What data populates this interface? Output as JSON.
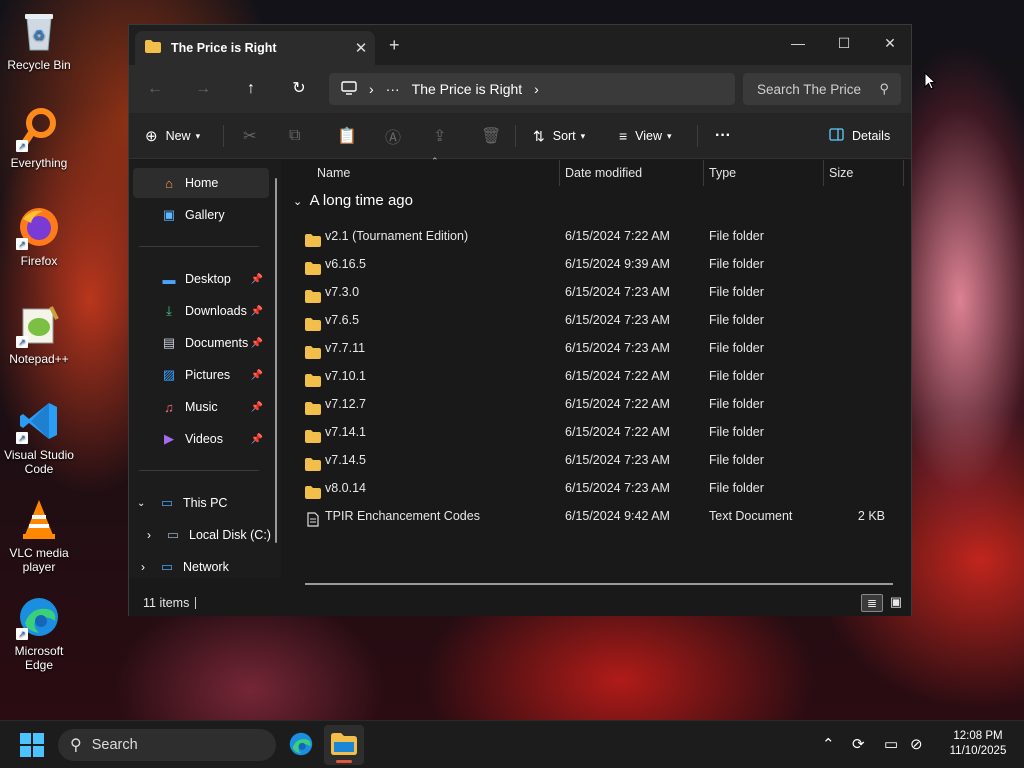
{
  "desktop": {
    "icons": [
      {
        "label": "Recycle Bin",
        "icon": "recycle-bin-icon"
      },
      {
        "label": "Everything",
        "icon": "everything-search-icon"
      },
      {
        "label": "Firefox",
        "icon": "firefox-icon"
      },
      {
        "label": "Notepad++",
        "icon": "notepad-plus-plus-icon"
      },
      {
        "label": "Visual Studio Code",
        "icon": "vscode-icon"
      },
      {
        "label": "VLC media player",
        "icon": "vlc-icon"
      },
      {
        "label": "Microsoft Edge",
        "icon": "edge-icon"
      }
    ]
  },
  "window": {
    "tab_title": "The Price is Right",
    "new_tab_symbol": "+",
    "controls": {
      "minimize": "—",
      "maximize": "☐",
      "close": "✕"
    },
    "nav": {
      "back": "←",
      "forward": "→",
      "up": "↑",
      "refresh": "↻"
    },
    "address": {
      "more": "···",
      "crumb": "The Price is Right"
    },
    "search_placeholder": "Search The Price",
    "toolbar": {
      "new_label": "New",
      "sort_label": "Sort",
      "view_label": "View",
      "more_label": "···",
      "details_label": "Details"
    }
  },
  "sidebar": {
    "home": "Home",
    "gallery": "Gallery",
    "quick_access": [
      {
        "label": "Desktop",
        "icon": "desktop-icon"
      },
      {
        "label": "Downloads",
        "icon": "downloads-icon"
      },
      {
        "label": "Documents",
        "icon": "documents-icon"
      },
      {
        "label": "Pictures",
        "icon": "pictures-icon"
      },
      {
        "label": "Music",
        "icon": "music-icon"
      },
      {
        "label": "Videos",
        "icon": "videos-icon"
      }
    ],
    "this_pc": "This PC",
    "local_disk": "Local Disk (C:)",
    "network": "Network"
  },
  "columns": {
    "name": "Name",
    "date": "Date modified",
    "type": "Type",
    "size": "Size"
  },
  "group_title": "A long time ago",
  "files": [
    {
      "name": "v2.1 (Tournament Edition)",
      "date": "6/15/2024 7:22 AM",
      "type": "File folder",
      "size": "",
      "kind": "folder"
    },
    {
      "name": "v6.16.5",
      "date": "6/15/2024 9:39 AM",
      "type": "File folder",
      "size": "",
      "kind": "folder"
    },
    {
      "name": "v7.3.0",
      "date": "6/15/2024 7:23 AM",
      "type": "File folder",
      "size": "",
      "kind": "folder"
    },
    {
      "name": "v7.6.5",
      "date": "6/15/2024 7:23 AM",
      "type": "File folder",
      "size": "",
      "kind": "folder"
    },
    {
      "name": "v7.7.11",
      "date": "6/15/2024 7:23 AM",
      "type": "File folder",
      "size": "",
      "kind": "folder"
    },
    {
      "name": "v7.10.1",
      "date": "6/15/2024 7:22 AM",
      "type": "File folder",
      "size": "",
      "kind": "folder"
    },
    {
      "name": "v7.12.7",
      "date": "6/15/2024 7:22 AM",
      "type": "File folder",
      "size": "",
      "kind": "folder"
    },
    {
      "name": "v7.14.1",
      "date": "6/15/2024 7:22 AM",
      "type": "File folder",
      "size": "",
      "kind": "folder"
    },
    {
      "name": "v7.14.5",
      "date": "6/15/2024 7:23 AM",
      "type": "File folder",
      "size": "",
      "kind": "folder"
    },
    {
      "name": "v8.0.14",
      "date": "6/15/2024 7:23 AM",
      "type": "File folder",
      "size": "",
      "kind": "folder"
    },
    {
      "name": "TPIR Enchancement Codes",
      "date": "6/15/2024 9:42 AM",
      "type": "Text Document",
      "size": "2 KB",
      "kind": "text"
    }
  ],
  "status": {
    "items_count": "11 items"
  },
  "taskbar": {
    "search_label": "Search",
    "time": "12:08 PM",
    "date": "11/10/2025"
  },
  "colors": {
    "folder": "#f2c04a",
    "accent": "#60cdff",
    "window_bg": "#191919"
  }
}
